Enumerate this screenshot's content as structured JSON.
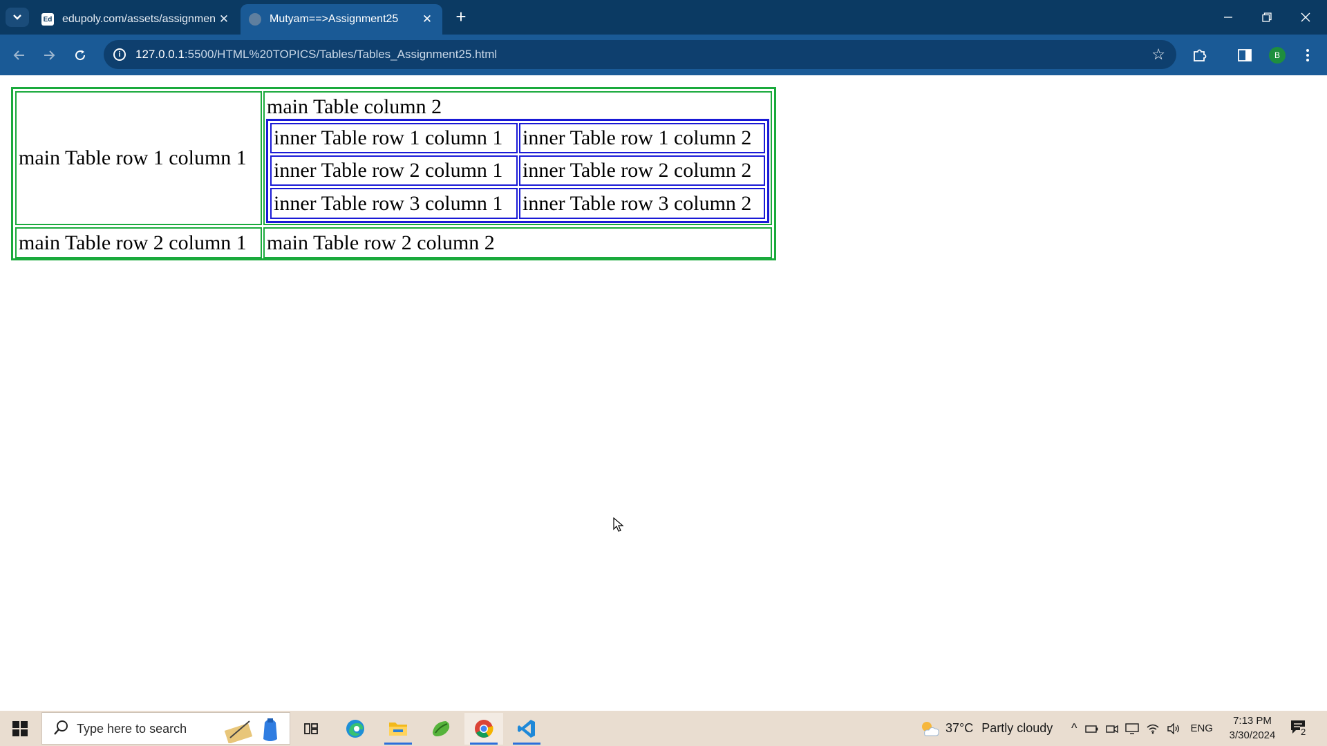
{
  "browser": {
    "tabs": [
      {
        "title": "edupoly.com/assets/assignmen",
        "favicon": "edupoly-favicon",
        "favicon_text": "Ed"
      },
      {
        "title": "Mutyam==>Assignment25",
        "favicon": "globe-icon"
      }
    ],
    "new_tab_label": "+",
    "url_host": "127.0.0.1",
    "url_rest": ":5500/HTML%20TOPICS/Tables/Tables_Assignment25.html",
    "profile_initial": "B"
  },
  "page": {
    "main_table": {
      "border_color": "#1aaa3c",
      "row1_col1": "main Table row 1 column 1",
      "col2_header": "main Table column 2",
      "row2_col1": "main Table row 2 column 1",
      "row2_col2": "main Table row 2 column 2"
    },
    "inner_table": {
      "border_color": "#1a1ad6",
      "rows": [
        [
          "inner Table row 1 column 1",
          "inner Table row 1 column 2"
        ],
        [
          "inner Table row 2 column 1",
          "inner Table row 2 column 2"
        ],
        [
          "inner Table row 3 column 1",
          "inner Table row 3 column 2"
        ]
      ]
    }
  },
  "taskbar": {
    "search_placeholder": "Type here to search",
    "apps": [
      "task-view-icon",
      "edge-icon",
      "file-explorer-icon",
      "green-app-icon",
      "chrome-icon",
      "vscode-icon"
    ],
    "weather_temp": "37°C",
    "weather_desc": "Partly cloudy",
    "language": "ENG",
    "time": "7:13 PM",
    "date": "3/30/2024",
    "notification_count": "2"
  }
}
